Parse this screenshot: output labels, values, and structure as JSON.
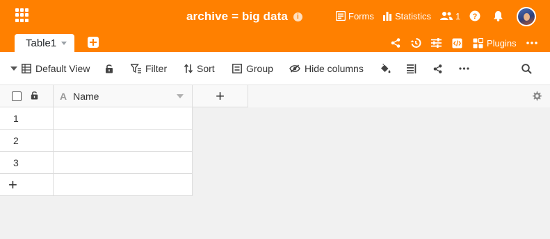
{
  "header": {
    "title": "archive = big data",
    "forms_label": "Forms",
    "statistics_label": "Statistics",
    "collaborators_count": "1",
    "plugins_label": "Plugins"
  },
  "tabs": [
    {
      "label": "Table1"
    }
  ],
  "toolbar": {
    "view_label": "Default View",
    "filter_label": "Filter",
    "sort_label": "Sort",
    "group_label": "Group",
    "hide_columns_label": "Hide columns"
  },
  "table": {
    "columns": [
      {
        "name": "Name",
        "type_icon": "A"
      }
    ],
    "add_column_label": "+",
    "rows": [
      {
        "number": "1",
        "name": ""
      },
      {
        "number": "2",
        "name": ""
      },
      {
        "number": "3",
        "name": ""
      }
    ],
    "add_row_label": "+"
  },
  "colors": {
    "brand": "#ff8000",
    "toolbar_bg": "#ffffff",
    "canvas_bg": "#f1f1f1"
  }
}
